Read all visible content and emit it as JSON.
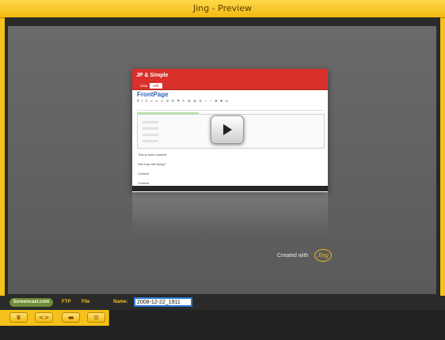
{
  "window": {
    "title": "Jing - Preview"
  },
  "preview": {
    "app_title": "JP & Simple",
    "tabs": [
      "view",
      "edit"
    ],
    "page_title": "FrontPage",
    "text_lines": [
      "This is more content",
      "See how this flying?",
      "Content",
      "Content"
    ],
    "created_with": "Created with",
    "logo_text": "Jing"
  },
  "share": {
    "screencast_label": "Screencast.com",
    "ftp_label": "FTP",
    "file_label": "File",
    "name_label": "Name:",
    "name_value": "2008-12-22_1911"
  },
  "toolbar": {
    "buttons": [
      {
        "icon": "crown-icon",
        "glyph": "♛"
      },
      {
        "icon": "embed-code-icon",
        "glyph": "<>"
      },
      {
        "icon": "save-icon",
        "glyph": "▬"
      },
      {
        "icon": "settings-icon",
        "glyph": "⊙"
      }
    ]
  },
  "colors": {
    "chrome": "#f5c11a",
    "accent_red": "#d9302b",
    "screencast_green": "#6e8a3b",
    "field_border": "#2a7bd3"
  }
}
